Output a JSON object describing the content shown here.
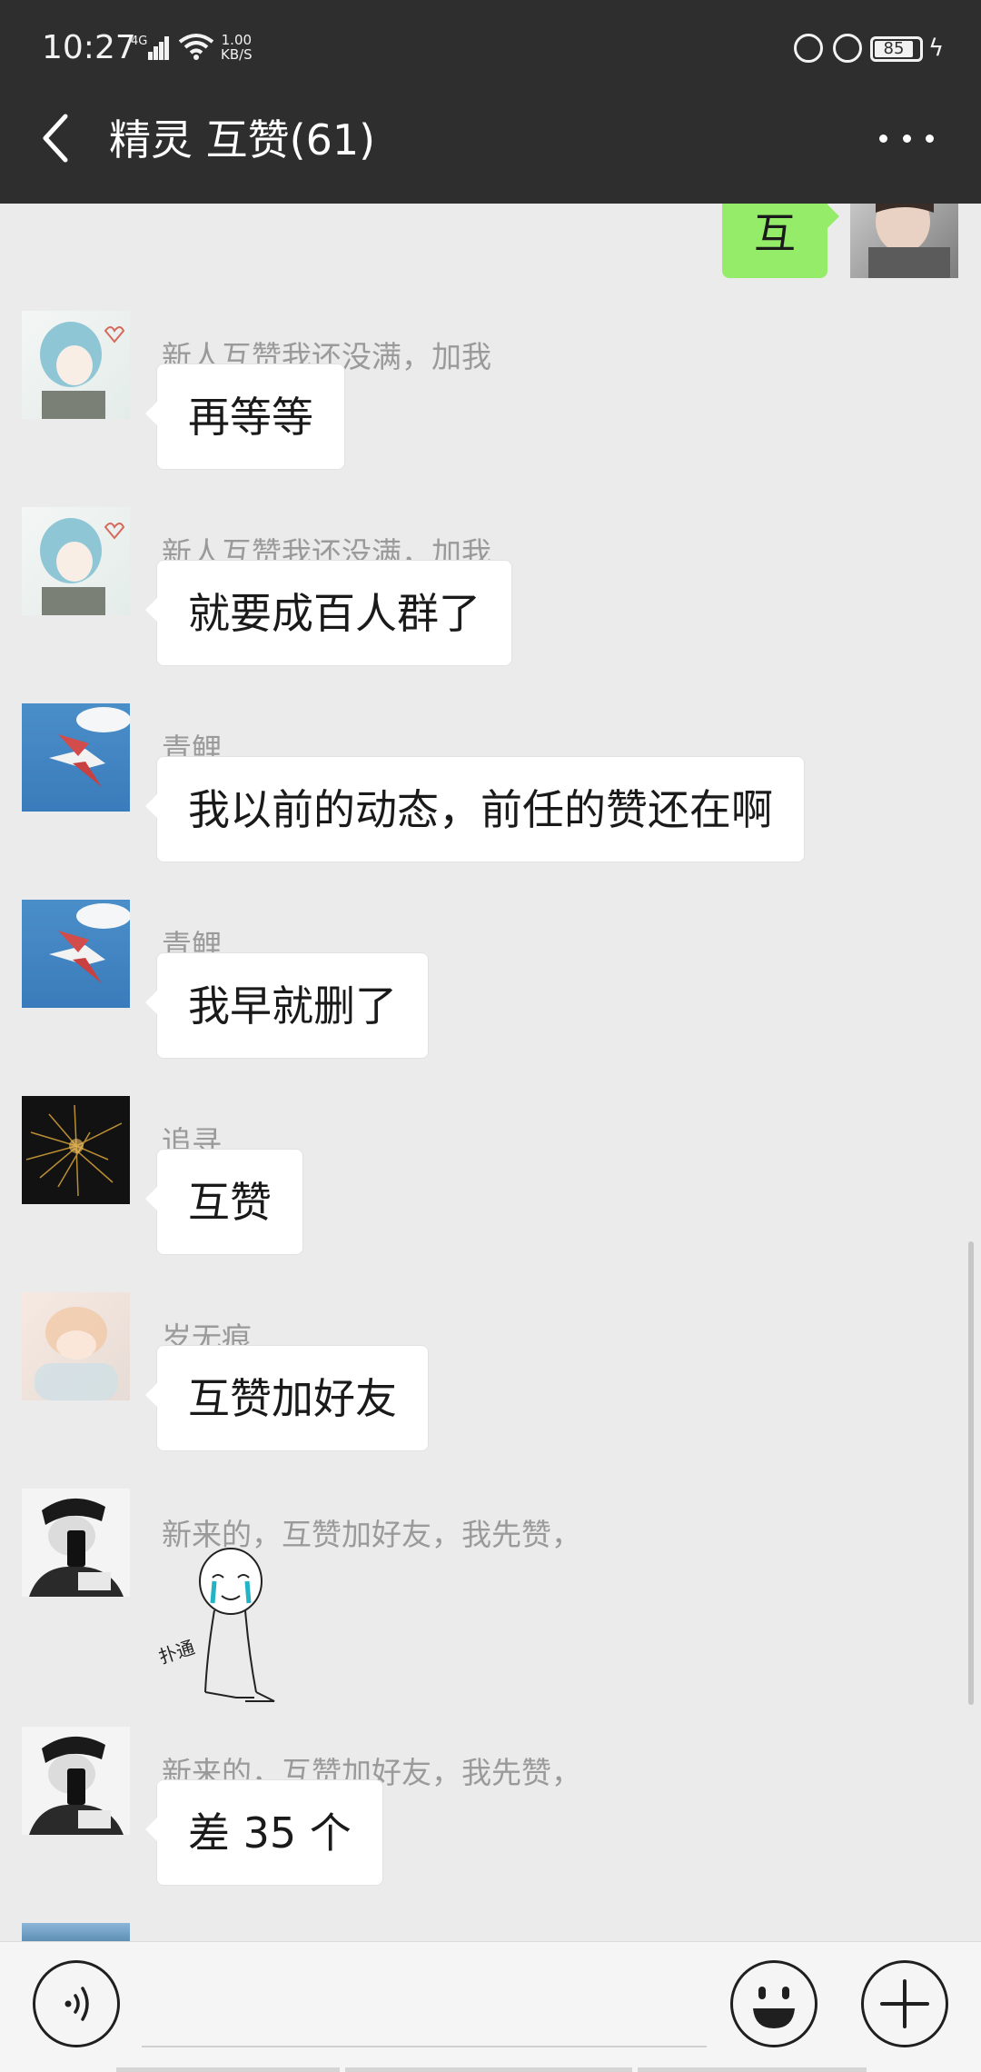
{
  "status_bar": {
    "time": "10:27",
    "network": "4G",
    "speed_value": "1.00",
    "speed_unit": "KB/S",
    "battery": "85"
  },
  "header": {
    "title": "精灵 互赞(61)"
  },
  "my_message": {
    "text": "互"
  },
  "messages": [
    {
      "sender": "新人互赞我还没满，加我",
      "text": "再等等"
    },
    {
      "sender": "新人互赞我还没满，加我",
      "text": "就要成百人群了"
    },
    {
      "sender": "青鲤",
      "text": "我以前的动态，前任的赞还在啊"
    },
    {
      "sender": "青鲤",
      "text": "我早就删了"
    },
    {
      "sender": "追寻",
      "text": "互赞"
    },
    {
      "sender": "岁无痕",
      "text": "互赞加好友"
    },
    {
      "sender": "新来的，互赞加好友，我先赞，",
      "sticker_text": "扑通"
    },
    {
      "sender": "新来的，互赞加好友，我先赞，",
      "text": "差 35 个"
    }
  ],
  "colors": {
    "header_bg": "#2e2e2e",
    "chat_bg": "#ebebeb",
    "my_bubble": "#95ec69",
    "other_bubble": "#ffffff"
  }
}
